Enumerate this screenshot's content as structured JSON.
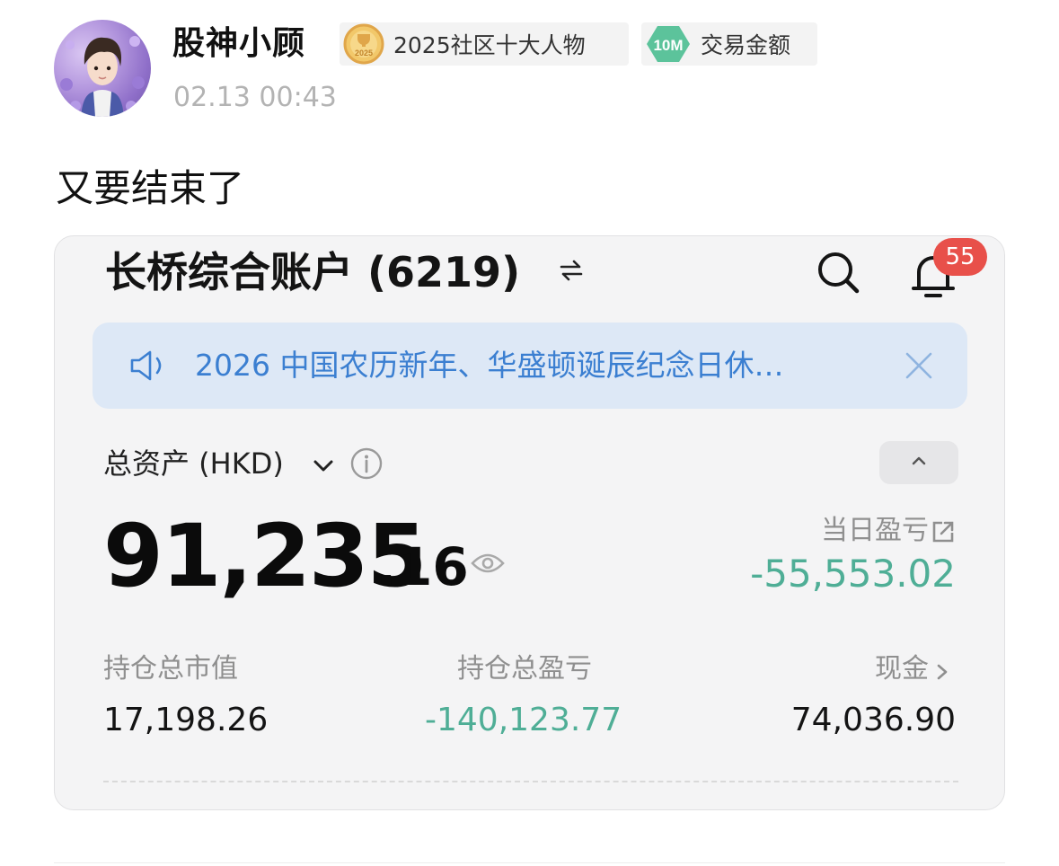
{
  "post": {
    "author": "股神小顾",
    "badges": [
      {
        "label": "2025社区十大人物",
        "icon": "medal-icon",
        "icon_text": "2025"
      },
      {
        "label": "交易金额",
        "icon": "10m-badge-icon",
        "icon_text": "10M"
      }
    ],
    "time": "02.13 00:43",
    "text": "又要结束了"
  },
  "screenshot": {
    "account_title": "长桥综合账户 (6219)",
    "notification_count": "55",
    "notice": "2026 中国农历新年、华盛顿诞辰纪念日休…",
    "total_assets_label": "总资产 (HKD)",
    "total_assets_int": "91,235",
    "total_assets_dec": ".16",
    "day_pl_label": "当日盈亏",
    "day_pl_value": "-55,553.02",
    "stats": [
      {
        "label": "持仓总市值",
        "value": "17,198.26"
      },
      {
        "label": "持仓总盈亏",
        "value": "-140,123.77"
      },
      {
        "label": "现金",
        "value": "74,036.90"
      }
    ]
  },
  "colors": {
    "gain_loss_green": "#4fae96",
    "notice_blue": "#3b7fd1",
    "notice_bg": "#dde8f6",
    "badge_red": "#e8504a",
    "badge_10m_green": "#5cc39b",
    "medal_gold": "#e0a64a"
  }
}
